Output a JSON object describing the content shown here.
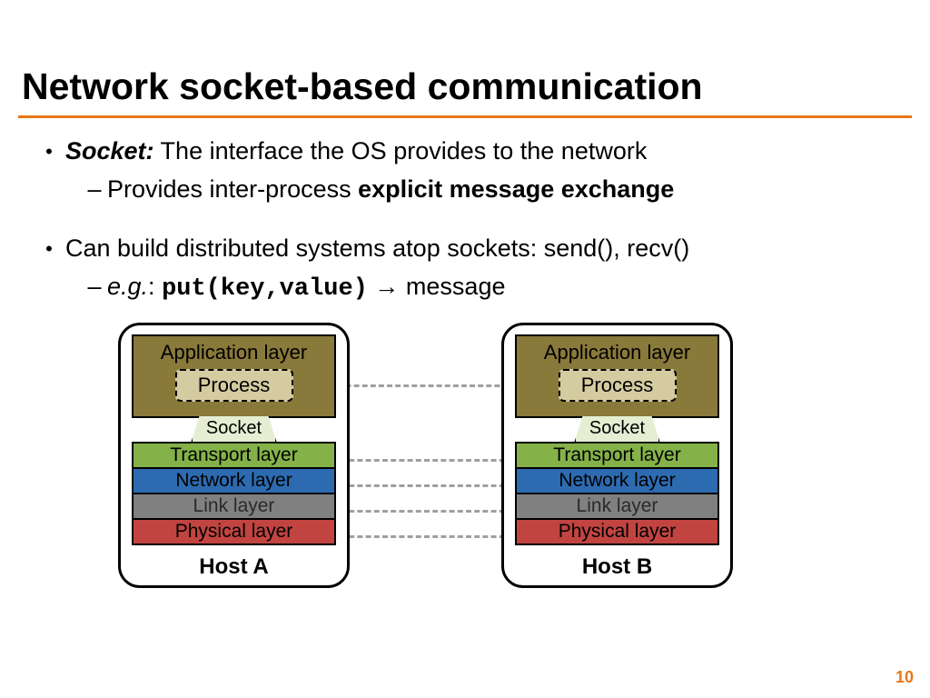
{
  "title": "Network socket-based communication",
  "bullets": {
    "b1_lead": "Socket:",
    "b1_rest": " The interface the OS provides to the network",
    "b1_sub_lead": "Provides inter-process ",
    "b1_sub_bold": "explicit message exchange",
    "b2": "Can build distributed systems atop sockets: send(), recv()",
    "b2_sub_lead": "e.g.",
    "b2_sub_colon": ": ",
    "b2_sub_code": "put(key,value)",
    "b2_sub_arrow": "  → ",
    "b2_sub_rest": "message"
  },
  "hosts": {
    "a": {
      "label": "Host A",
      "app": "Application layer",
      "process": "Process",
      "socket": "Socket",
      "transport": "Transport layer",
      "network": "Network layer",
      "link": "Link layer",
      "physical": "Physical layer"
    },
    "b": {
      "label": "Host B",
      "app": "Application layer",
      "process": "Process",
      "socket": "Socket",
      "transport": "Transport layer",
      "network": "Network layer",
      "link": "Link layer",
      "physical": "Physical layer"
    }
  },
  "page_number": "10"
}
